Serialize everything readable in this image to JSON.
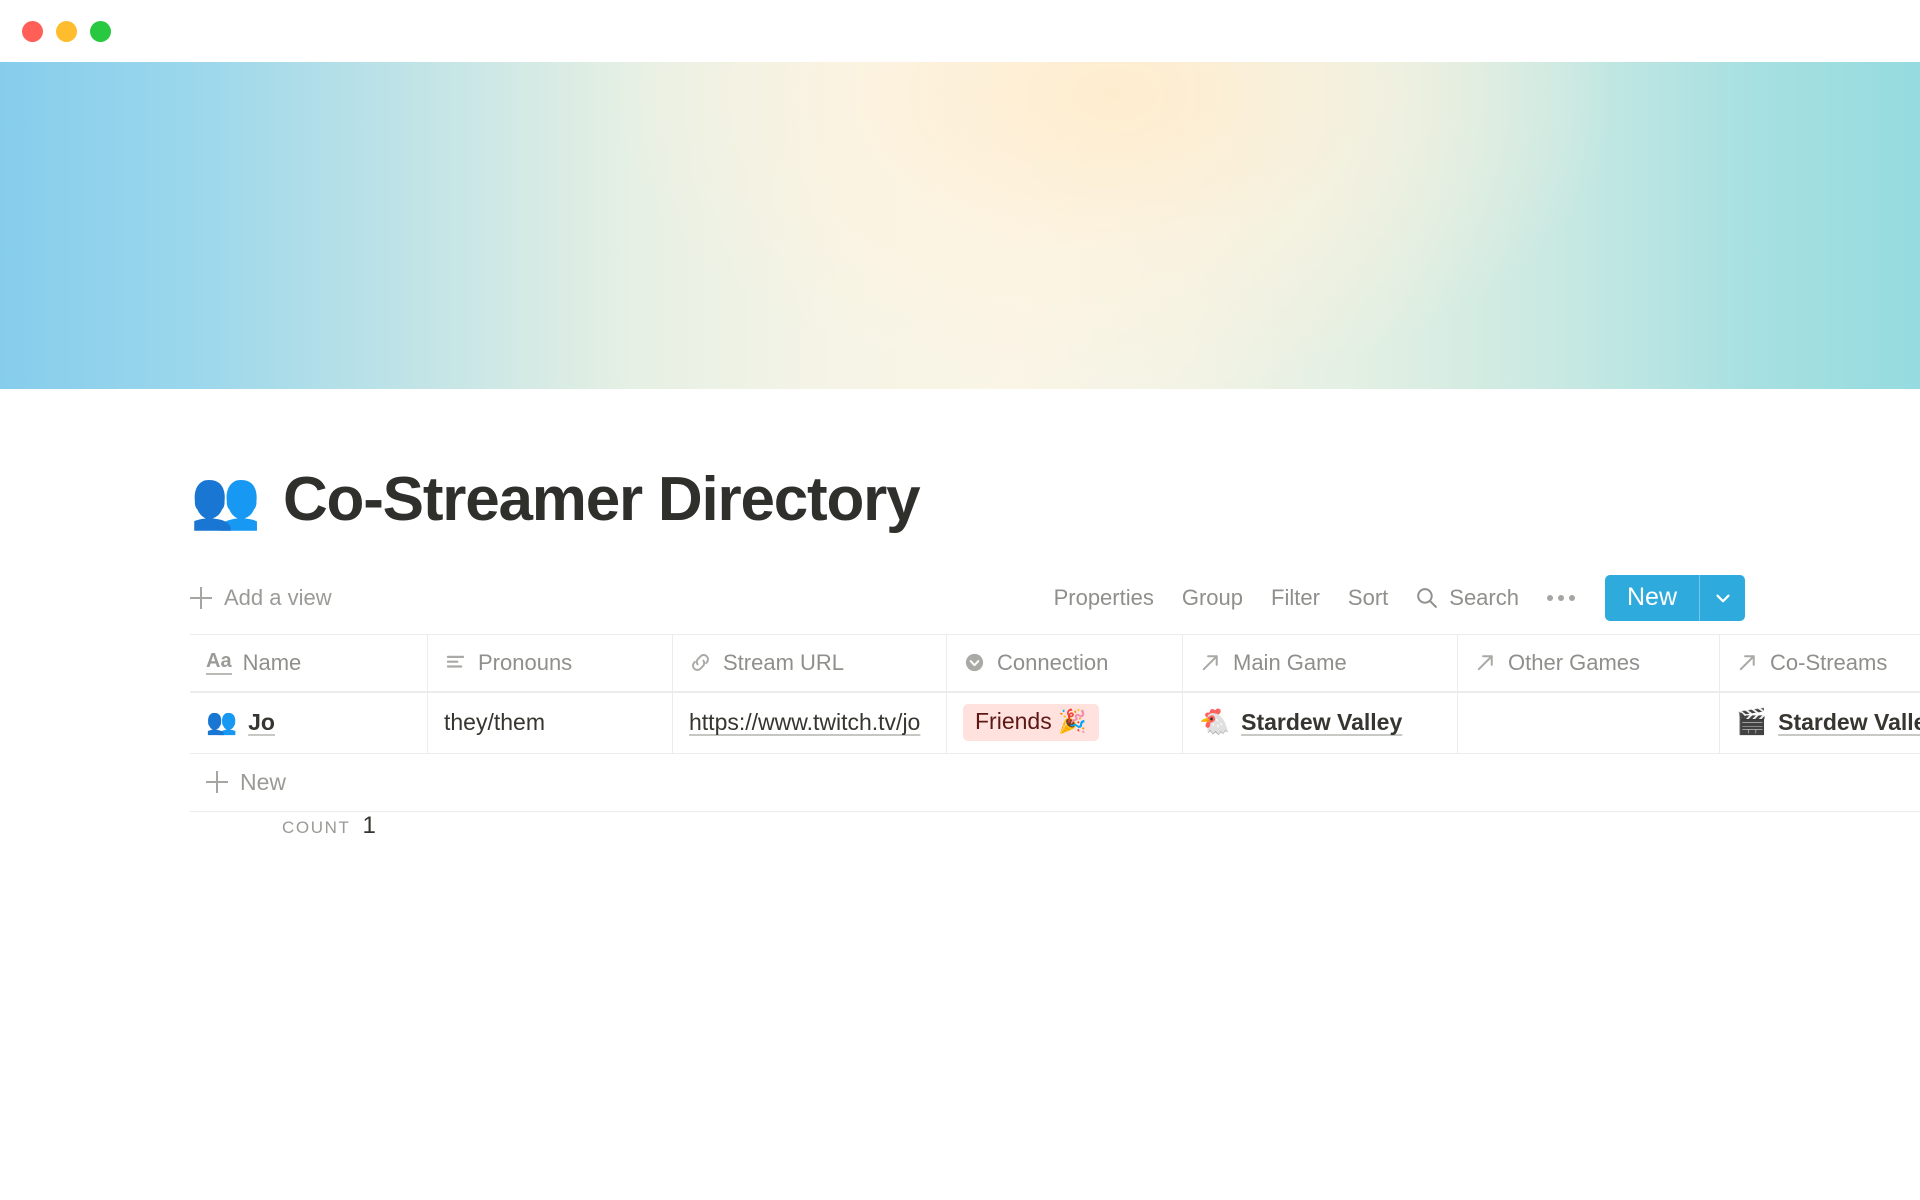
{
  "window": {
    "traffic_lights": [
      {
        "name": "close",
        "color": "#ff5f57"
      },
      {
        "name": "minimize",
        "color": "#ffbd2e"
      },
      {
        "name": "maximize",
        "color": "#28c840"
      }
    ]
  },
  "cover": {
    "gradient_left": "#86cdec",
    "gradient_center": "#faf5e7",
    "gradient_right": "#95dbdf"
  },
  "page": {
    "icon": "👥",
    "title": "Co-Streamer Directory"
  },
  "toolbar": {
    "add_view_label": "Add a view",
    "add_view_icon": "plus-icon",
    "properties_label": "Properties",
    "group_label": "Group",
    "filter_label": "Filter",
    "sort_label": "Sort",
    "search_label": "Search",
    "search_icon": "search-icon",
    "more_icon": "ellipsis-icon",
    "new_label": "New",
    "new_caret_icon": "chevron-down-icon",
    "new_button_color": "#2eaadc"
  },
  "table": {
    "columns": [
      {
        "label": "Name",
        "icon": "title-aa-icon",
        "type": "title"
      },
      {
        "label": "Pronouns",
        "icon": "text-lines-icon",
        "type": "text"
      },
      {
        "label": "Stream URL",
        "icon": "link-icon",
        "type": "url"
      },
      {
        "label": "Connection",
        "icon": "select-icon",
        "type": "select"
      },
      {
        "label": "Main Game",
        "icon": "relation-arrow-icon",
        "type": "relation"
      },
      {
        "label": "Other Games",
        "icon": "relation-arrow-icon",
        "type": "relation"
      },
      {
        "label": "Co-Streams",
        "icon": "relation-arrow-icon",
        "type": "relation"
      }
    ],
    "rows": [
      {
        "name": "Jo",
        "name_emoji": "👥",
        "pronouns": "they/them",
        "stream_url": "https://www.twitch.tv/jo",
        "connection": "Friends 🎉",
        "connection_bg": "#ffe2dd",
        "connection_fg": "#5d1715",
        "main_game": "Stardew Valley",
        "main_game_emoji": "🐔",
        "other_games": "",
        "co_streams": "Stardew Valley Co-op",
        "co_streams_emoji": "🎬"
      }
    ],
    "new_row_label": "New",
    "new_row_icon": "plus-icon",
    "count_label": "COUNT",
    "count_value": "1"
  }
}
